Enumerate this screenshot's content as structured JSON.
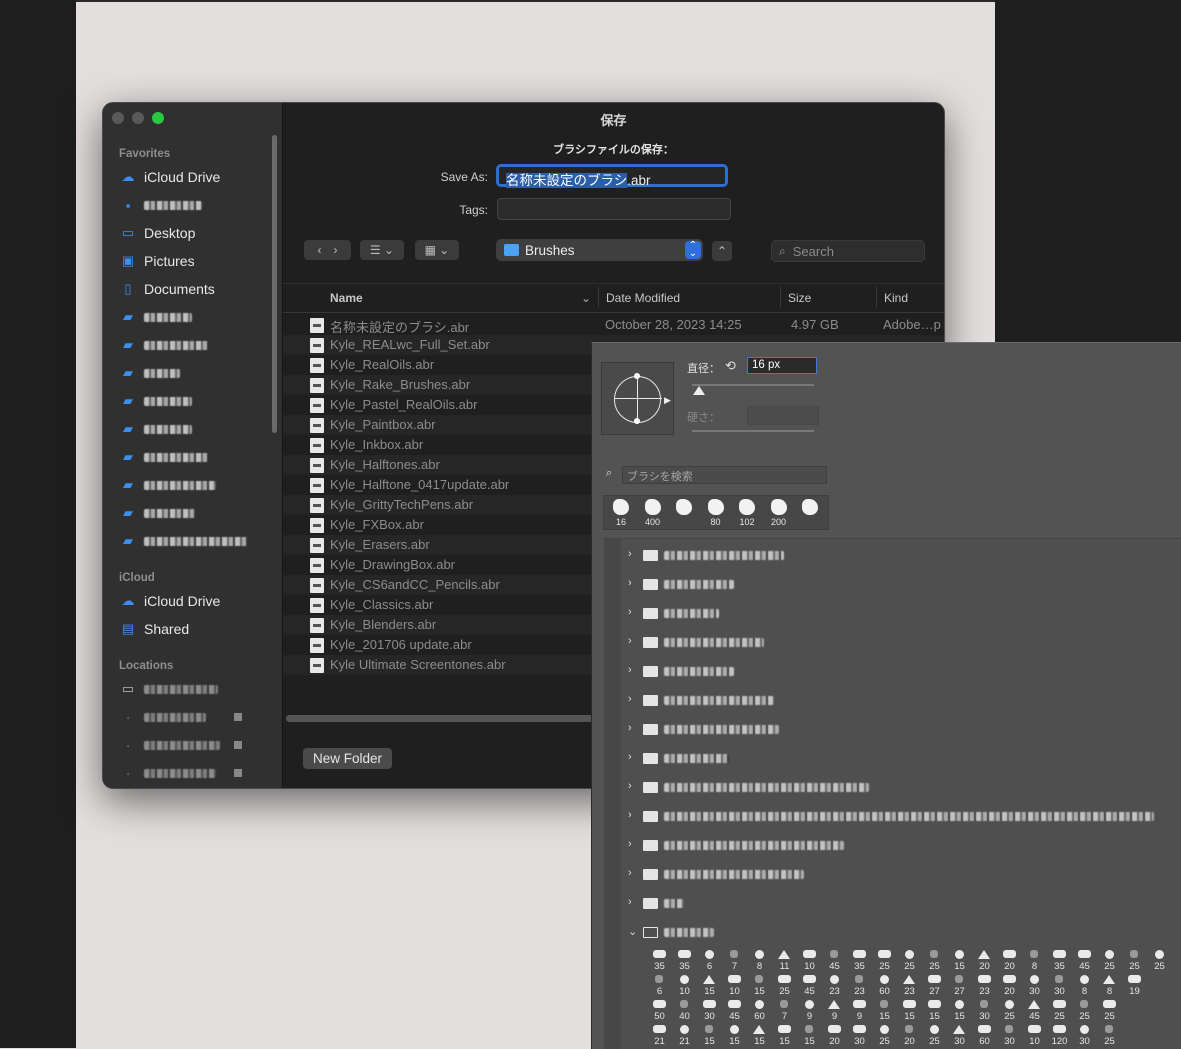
{
  "dialog": {
    "title": "保存",
    "subtitle": "ブラシファイルの保存：",
    "save_as_label": "Save As:",
    "file_name_selected": "名称未設定のブラシ",
    "file_name_ext": ".abr",
    "tags_label": "Tags:",
    "location": "Brushes",
    "search_placeholder": "Search",
    "new_folder_label": "New Folder"
  },
  "sidebar": {
    "favorites_heading": "Favorites",
    "favorites": [
      {
        "label": "iCloud Drive",
        "icon": "cloud-icon"
      },
      {
        "label": "",
        "icon": "user-folder-icon",
        "redacted": true
      },
      {
        "label": "Desktop",
        "icon": "desktop-icon"
      },
      {
        "label": "Pictures",
        "icon": "pictures-icon"
      },
      {
        "label": "Documents",
        "icon": "document-icon"
      }
    ],
    "icloud_heading": "iCloud",
    "icloud": [
      {
        "label": "iCloud Drive",
        "icon": "cloud-icon"
      },
      {
        "label": "Shared",
        "icon": "shared-folder-icon"
      }
    ],
    "locations_heading": "Locations"
  },
  "columns": {
    "name": "Name",
    "date": "Date Modified",
    "size": "Size",
    "kind": "Kind"
  },
  "files": [
    {
      "name": "名称未設定のブラシ.abr",
      "date": "October 28, 2023 14:25",
      "size": "4.97 GB",
      "kind": "Adobe…p"
    },
    {
      "name": "Kyle_REALwc_Full_Set.abr",
      "date": "",
      "size": "",
      "kind": ""
    },
    {
      "name": "Kyle_RealOils.abr",
      "date": "",
      "size": "",
      "kind": ""
    },
    {
      "name": "Kyle_Rake_Brushes.abr",
      "date": "",
      "size": "",
      "kind": ""
    },
    {
      "name": "Kyle_Pastel_RealOils.abr",
      "date": "",
      "size": "",
      "kind": ""
    },
    {
      "name": "Kyle_Paintbox.abr",
      "date": "",
      "size": "",
      "kind": ""
    },
    {
      "name": "Kyle_Inkbox.abr",
      "date": "",
      "size": "",
      "kind": ""
    },
    {
      "name": "Kyle_Halftones.abr",
      "date": "",
      "size": "",
      "kind": ""
    },
    {
      "name": "Kyle_Halftone_0417update.abr",
      "date": "",
      "size": "",
      "kind": ""
    },
    {
      "name": "Kyle_GrittyTechPens.abr",
      "date": "",
      "size": "",
      "kind": ""
    },
    {
      "name": "Kyle_FXBox.abr",
      "date": "",
      "size": "",
      "kind": ""
    },
    {
      "name": "Kyle_Erasers.abr",
      "date": "",
      "size": "",
      "kind": ""
    },
    {
      "name": "Kyle_DrawingBox.abr",
      "date": "",
      "size": "",
      "kind": ""
    },
    {
      "name": "Kyle_CS6andCC_Pencils.abr",
      "date": "",
      "size": "",
      "kind": ""
    },
    {
      "name": "Kyle_Classics.abr",
      "date": "",
      "size": "",
      "kind": ""
    },
    {
      "name": "Kyle_Blenders.abr",
      "date": "",
      "size": "",
      "kind": ""
    },
    {
      "name": "Kyle_201706 update.abr",
      "date": "",
      "size": "",
      "kind": ""
    },
    {
      "name": "Kyle Ultimate Screentones.abr",
      "date": "",
      "size": "",
      "kind": ""
    }
  ],
  "brush_panel": {
    "size_label": "直径：",
    "size_value": "16 px",
    "hardness_label": "硬さ：",
    "search_placeholder": "ブラシを検索",
    "recent_sizes": [
      "16",
      "400",
      "",
      "80",
      "102",
      "200",
      ""
    ],
    "group_count": 14,
    "grid_sizes": [
      [
        "35",
        "35",
        "6",
        "7",
        "8",
        "11",
        "10",
        "45",
        "35",
        "25",
        "25",
        "25",
        "15",
        "20",
        "20",
        "8",
        "35",
        "45",
        "25",
        "25",
        "25"
      ],
      [
        "6",
        "10",
        "15",
        "10",
        "15",
        "25",
        "45",
        "23",
        "23",
        "60",
        "23",
        "27",
        "27",
        "23",
        "20",
        "30",
        "30",
        "8",
        "8",
        "19"
      ],
      [
        "50",
        "40",
        "30",
        "45",
        "60",
        "7",
        "9",
        "9",
        "9",
        "15",
        "15",
        "15",
        "15",
        "30",
        "25",
        "45",
        "25",
        "25",
        "25"
      ],
      [
        "21",
        "21",
        "15",
        "15",
        "15",
        "15",
        "15",
        "20",
        "30",
        "25",
        "20",
        "25",
        "30",
        "60",
        "30",
        "10",
        "120",
        "30",
        "25"
      ]
    ]
  },
  "colors": {
    "accent": "#2b6fcf",
    "folder": "#4aa3f5",
    "close": "#5a5a5a",
    "minimize": "#5a5a5a",
    "zoom": "#2ac840"
  }
}
